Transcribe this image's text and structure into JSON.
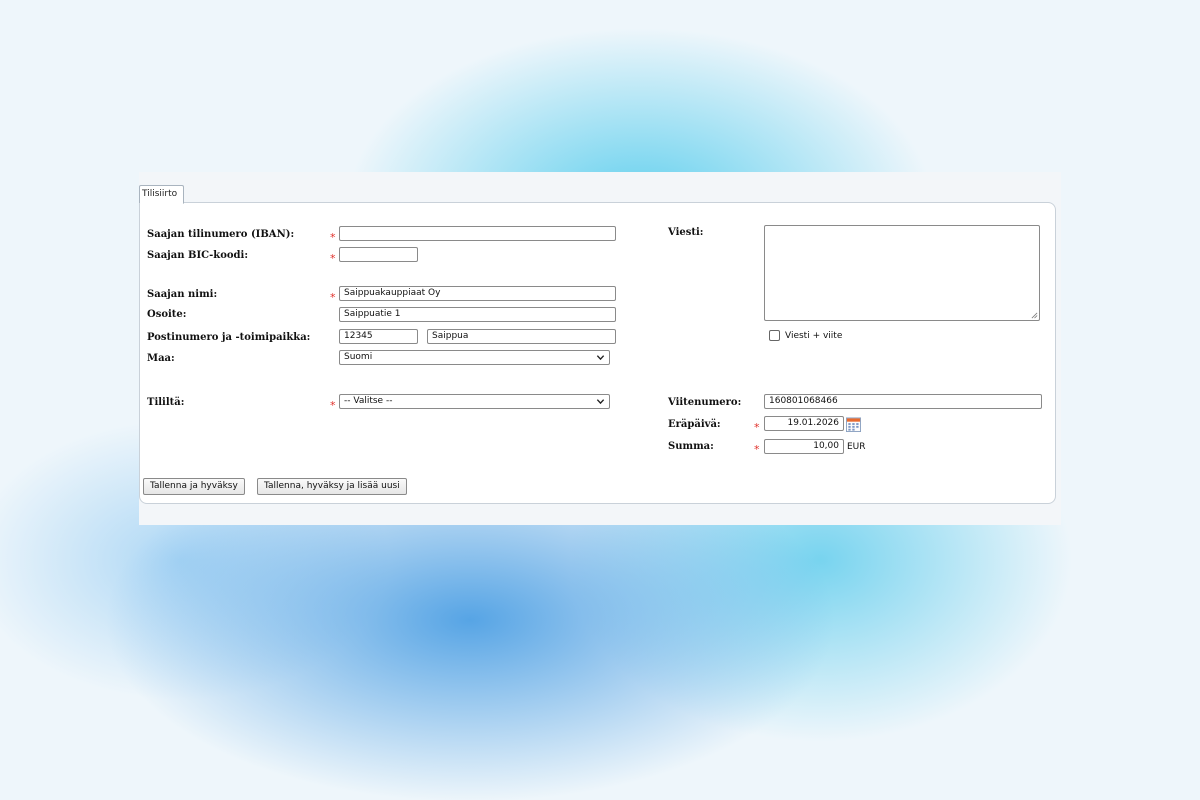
{
  "tab": {
    "label": "Tilisiirto"
  },
  "form": {
    "iban": {
      "label": "Saajan tilinumero (IBAN):",
      "value": ""
    },
    "bic": {
      "label": "Saajan BIC-koodi:",
      "value": ""
    },
    "name": {
      "label": "Saajan nimi:",
      "value": "Saippuakauppiaat Oy"
    },
    "address": {
      "label": "Osoite:",
      "value": "Saippuatie 1"
    },
    "postal": {
      "label": "Postinumero ja -toimipaikka:",
      "code": "12345",
      "city": "Saippua"
    },
    "country": {
      "label": "Maa:",
      "selected": "Suomi"
    },
    "account": {
      "label": "Tililtä:",
      "selected": "-- Valitse --"
    },
    "message": {
      "label": "Viesti:",
      "value": "",
      "checkbox_label": "Viesti + viite",
      "checked": false
    },
    "reference": {
      "label": "Viitenumero:",
      "value": "160801068466"
    },
    "due_date": {
      "label": "Eräpäivä:",
      "value": "19.01.2026"
    },
    "amount": {
      "label": "Summa:",
      "value": "10,00",
      "currency": "EUR"
    },
    "required_mark": "*"
  },
  "buttons": {
    "save_approve": "Tallenna ja hyväksy",
    "save_approve_new": "Tallenna, hyväksy ja lisää uusi"
  },
  "colors": {
    "required": "#e0302a",
    "background_accent": "#46c8eb"
  },
  "icons": {
    "calendar": "calendar-icon",
    "dropdown": "chevron-down-icon",
    "resize": "resize-handle-icon"
  }
}
